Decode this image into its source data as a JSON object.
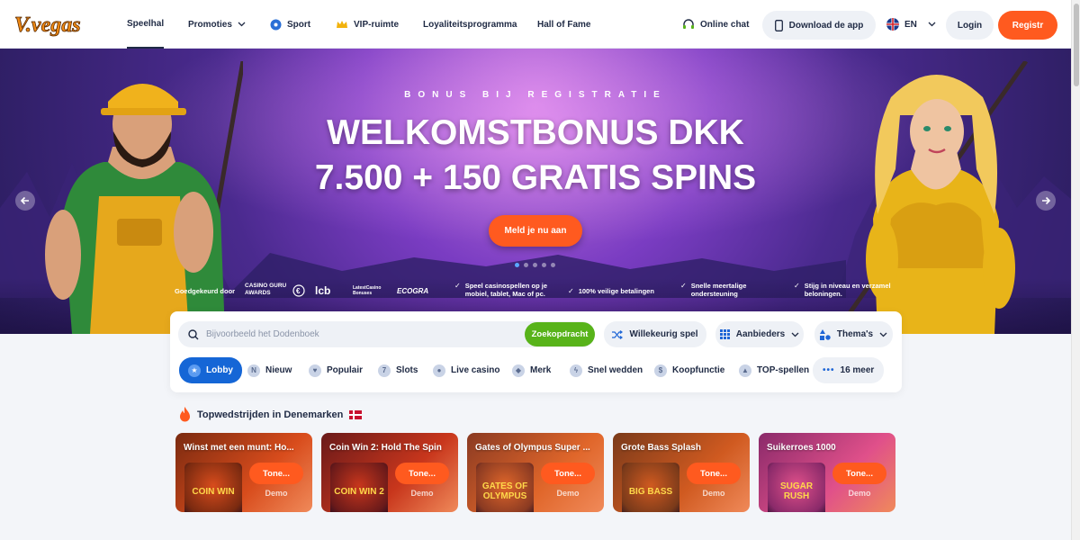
{
  "brand": {
    "logo_text": "V.vegas"
  },
  "nav": {
    "lobby": "Speelhal",
    "promotions": "Promoties",
    "sport": "Sport",
    "vip": "VIP-ruimte",
    "loyalty": "Loyaliteitsprogramma",
    "hall_of_fame": "Hall of Fame"
  },
  "header_actions": {
    "chat": "Online chat",
    "download": "Download de app",
    "language": "EN",
    "login": "Login",
    "register": "Registr"
  },
  "hero": {
    "subtitle": "BONUS BIJ REGISTRATIE",
    "title_line1": "WELKOMSTBONUS DKK",
    "title_line2": "7.500 + 150 GRATIS SPINS",
    "cta": "Meld je nu aan",
    "approved_by": "Goedgekeurd door",
    "badges": [
      "CASINO GURU AWARDS",
      "lcb",
      "LatestCasino Bonuses",
      "ECOGRA"
    ],
    "features": [
      "Speel casinospellen op je mobiel, tablet, Mac of pc.",
      "100% veilige betalingen",
      "Snelle meertalige ondersteuning",
      "Stijg in niveau en verzamel beloningen."
    ],
    "slides_total": 5,
    "slide_active": 1
  },
  "search": {
    "placeholder": "Bijvoorbeeld het Dodenboek",
    "button": "Zoekopdracht",
    "random": "Willekeurig spel",
    "providers": "Aanbieders",
    "themes": "Thema's"
  },
  "categories": [
    {
      "label": "Lobby",
      "icon": "trophy-icon"
    },
    {
      "label": "Nieuw",
      "icon": "new-icon"
    },
    {
      "label": "Populair",
      "icon": "heart-icon"
    },
    {
      "label": "Slots",
      "icon": "slots-icon"
    },
    {
      "label": "Live casino",
      "icon": "live-casino-icon"
    },
    {
      "label": "Merk",
      "icon": "brand-icon"
    },
    {
      "label": "Snel wedden",
      "icon": "lightning-icon"
    },
    {
      "label": "Koopfunctie",
      "icon": "coin-icon"
    },
    {
      "label": "TOP-spellen",
      "icon": "flame-icon"
    },
    {
      "label": "16 meer",
      "icon": "more-icon"
    }
  ],
  "section": {
    "title": "Topwedstrijden in Denemarken"
  },
  "games": [
    {
      "name": "Winst met een munt: Ho...",
      "thumb": "COIN WIN",
      "show": "Tone...",
      "demo": "Demo",
      "color1": "#7a2a10",
      "color2": "#d84c1c"
    },
    {
      "name": "Coin Win 2: Hold The Spin",
      "thumb": "COIN WIN 2",
      "show": "Tone...",
      "demo": "Demo",
      "color1": "#6a1a1a",
      "color2": "#c8361c"
    },
    {
      "name": "Gates of Olympus Super ...",
      "thumb": "GATES OF OLYMPUS",
      "show": "Tone...",
      "demo": "Demo",
      "color1": "#8a3a22",
      "color2": "#e0662a"
    },
    {
      "name": "Grote Bass Splash",
      "thumb": "BIG BASS",
      "show": "Tone...",
      "demo": "Demo",
      "color1": "#7a3a1a",
      "color2": "#d05a20"
    },
    {
      "name": "Suikerroes 1000",
      "thumb": "SUGAR RUSH",
      "show": "Tone...",
      "demo": "Demo",
      "color1": "#8a2a6a",
      "color2": "#e0508a"
    }
  ]
}
